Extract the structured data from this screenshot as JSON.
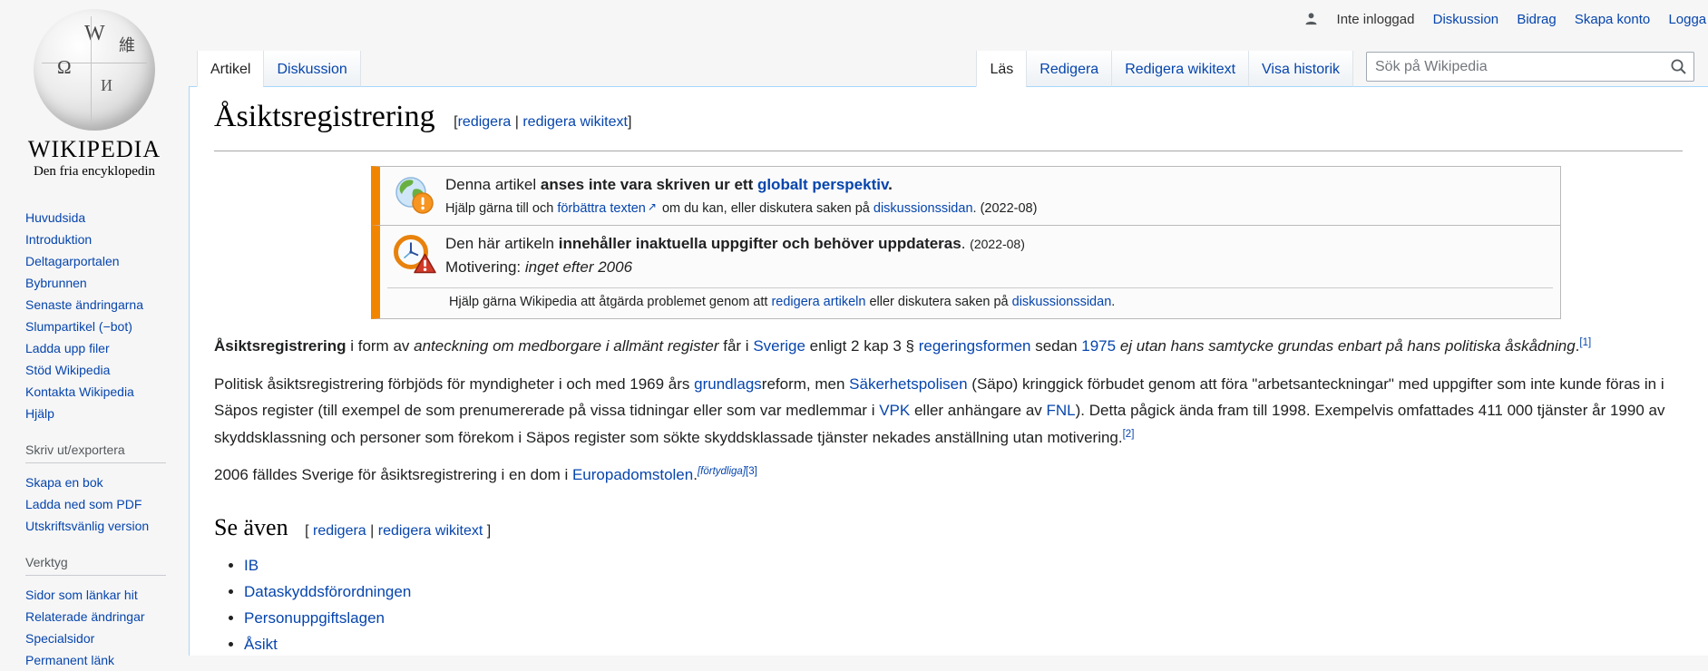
{
  "colors": {
    "link_blue": "#0645ad",
    "tab_border_blue": "#a7d7f9",
    "notice_orange": "#f28500",
    "heading_rule": "#a7a7a7"
  },
  "personal_bar": {
    "username_status": "Inte inloggad",
    "links": [
      "Diskussion",
      "Bidrag",
      "Skapa konto",
      "Logga in"
    ]
  },
  "tabs": {
    "left": [
      {
        "label": "Artikel",
        "active": true
      },
      {
        "label": "Diskussion",
        "active": false
      }
    ],
    "right": [
      {
        "label": "Läs",
        "active": true
      },
      {
        "label": "Redigera",
        "active": false
      },
      {
        "label": "Redigera wikitext",
        "active": false
      },
      {
        "label": "Visa historik",
        "active": false
      }
    ]
  },
  "search": {
    "placeholder": "Sök på Wikipedia"
  },
  "logo": {
    "wordmark": "WIKIPEDIA",
    "tagline": "Den fria encyklopedin",
    "globe_glyphs": [
      "W",
      "Ω",
      "維",
      "И"
    ]
  },
  "sidebar": {
    "nav": [
      "Huvudsida",
      "Introduktion",
      "Deltagarportalen",
      "Bybrunnen",
      "Senaste ändringarna",
      "Slumpartikel (−bot)",
      "Ladda upp filer",
      "Stöd Wikipedia",
      "Kontakta Wikipedia",
      "Hjälp"
    ],
    "print_export": {
      "title": "Skriv ut/exportera",
      "items": [
        "Skapa en bok",
        "Ladda ned som PDF",
        "Utskriftsvänlig version"
      ]
    },
    "tools": {
      "title": "Verktyg",
      "items": [
        "Sidor som länkar hit",
        "Relaterade ändringar",
        "Specialsidor",
        "Permanent länk"
      ]
    }
  },
  "article": {
    "title": "Åsiktsregistrering",
    "title_edit_segments": [
      {
        "t": "["
      },
      {
        "t": "redigera",
        "c": "a"
      },
      {
        "t": " | "
      },
      {
        "t": "redigera wikitext",
        "c": "a"
      },
      {
        "t": "]"
      }
    ],
    "paragraphs": [
      {
        "segments": [
          {
            "t": "Åsiktsregistrering",
            "c": "b"
          },
          {
            "t": " i form av "
          },
          {
            "t": "anteckning om medborgare i allmänt register",
            "c": "i"
          },
          {
            "t": " får i "
          },
          {
            "t": "Sverige",
            "c": "a"
          },
          {
            "t": " enligt 2 kap 3 § "
          },
          {
            "t": "regeringsformen",
            "c": "a"
          },
          {
            "t": " sedan "
          },
          {
            "t": "1975",
            "c": "a"
          },
          {
            "t": " "
          },
          {
            "t": "ej utan hans samtycke grundas enbart på hans politiska åskådning",
            "c": "i"
          },
          {
            "t": "."
          },
          {
            "t": "[1]",
            "c": "a sup"
          }
        ]
      },
      {
        "segments": [
          {
            "t": "Politisk åsiktsregistrering förbjöds för myndigheter i och med 1969 års "
          },
          {
            "t": "grundlags",
            "c": "a"
          },
          {
            "t": "reform, men "
          },
          {
            "t": "Säkerhetspolisen",
            "c": "a"
          },
          {
            "t": " (Säpo) kringgick förbudet genom att föra \"arbetsanteckningar\" med uppgifter som inte kunde föras in i Säpos register (till exempel de som prenumererade på vissa tidningar eller som var medlemmar i "
          },
          {
            "t": "VPK",
            "c": "a"
          },
          {
            "t": " eller anhängare av "
          },
          {
            "t": "FNL",
            "c": "a"
          },
          {
            "t": "). Detta pågick ända fram till 1998. Exempelvis omfattades 411 000 tjänster år 1990 av skyddsklassning och personer som förekom i Säpos register som sökte skyddsklassade tjänster nekades anställning utan motivering."
          },
          {
            "t": "[2]",
            "c": "a sup"
          }
        ]
      },
      {
        "segments": [
          {
            "t": "2006 fälldes Sverige för åsiktsregistrering i en dom i "
          },
          {
            "t": "Europadomstolen",
            "c": "a"
          },
          {
            "t": "."
          },
          {
            "t": "[förtydliga]",
            "c": "a sup i"
          },
          {
            "t": "[3]",
            "c": "a sup"
          }
        ]
      }
    ],
    "se_aven": {
      "heading": "Se även",
      "edit_segments": [
        {
          "t": "[ "
        },
        {
          "t": "redigera",
          "c": "a"
        },
        {
          "t": " | "
        },
        {
          "t": "redigera wikitext",
          "c": "a"
        },
        {
          "t": " ]"
        }
      ],
      "items": [
        "IB",
        "Dataskyddsförordningen",
        "Personuppgiftslagen",
        "Åsikt"
      ]
    }
  },
  "notices": [
    {
      "icon": "globe-issue-icon",
      "lines": [
        {
          "segments": [
            {
              "t": "Denna artikel "
            },
            {
              "t": "anses inte vara skriven ur ett ",
              "c": "b"
            },
            {
              "t": "globalt perspektiv",
              "c": "b a"
            },
            {
              "t": ".",
              "c": "b"
            }
          ]
        },
        {
          "segments": [
            {
              "t": "Hjälp gärna till och "
            },
            {
              "t": "förbättra texten",
              "c": "a"
            },
            {
              "t": "↗",
              "c": "a ext",
              "n": "external-link-icon"
            },
            {
              "t": " om du kan, eller diskutera saken på "
            },
            {
              "t": "diskussionssidan",
              "c": "a"
            },
            {
              "t": ". (2022-08)"
            }
          ]
        }
      ]
    },
    {
      "icon": "clock-warning-icon",
      "lines": [
        {
          "segments": [
            {
              "t": "Den här artikeln "
            },
            {
              "t": "innehåller inaktuella uppgifter och behöver uppdateras",
              "c": "b"
            },
            {
              "t": ". "
            },
            {
              "t": "(2022-08)",
              "c": "sm"
            }
          ]
        },
        {
          "segments": [
            {
              "t": "Motivering: "
            },
            {
              "t": "inget efter 2006",
              "c": "i"
            }
          ]
        }
      ],
      "note": {
        "segments": [
          {
            "t": "Hjälp gärna Wikipedia att åtgärda problemet genom att "
          },
          {
            "t": "redigera artikeln",
            "c": "a"
          },
          {
            "t": " eller diskutera saken på "
          },
          {
            "t": "diskussionssidan",
            "c": "a"
          },
          {
            "t": "."
          }
        ]
      }
    }
  ]
}
